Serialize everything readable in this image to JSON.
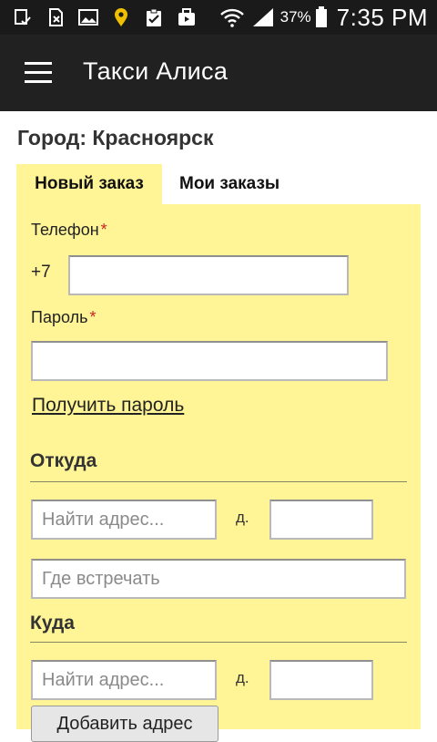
{
  "status_bar": {
    "icons": [
      "download-done-icon",
      "sim-off-icon",
      "image-icon",
      "location-pin-icon",
      "clipboard-check-icon",
      "briefcase-icon"
    ],
    "wifi_icon": "wifi-icon",
    "signal_icon": "signal-icon",
    "battery_percent": "37%",
    "battery_icon": "battery-icon",
    "time": "7:35 PM"
  },
  "app_bar": {
    "menu_icon": "hamburger-menu-icon",
    "title": "Такси Алиса"
  },
  "city_label": "Город: Красноярск",
  "tabs": [
    {
      "label": "Новый заказ",
      "active": true
    },
    {
      "label": "Мои заказы",
      "active": false
    }
  ],
  "form": {
    "phone": {
      "label": "Телефон",
      "required_mark": "*",
      "prefix": "+7",
      "value": ""
    },
    "password": {
      "label": "Пароль",
      "required_mark": "*",
      "value": ""
    },
    "get_password_link": "Получить пароль",
    "from": {
      "heading": "Откуда",
      "address_placeholder": "Найти адрес...",
      "house_label": "д.",
      "house_value": "",
      "meeting_placeholder": "Где встречать"
    },
    "to": {
      "heading": "Куда",
      "address_placeholder": "Найти адрес...",
      "house_label": "д.",
      "house_value": ""
    },
    "add_address_button": "Добавить адрес"
  },
  "colors": {
    "status_bar_bg": "#1a1a1a",
    "app_bar_bg": "#212121",
    "form_bg": "#fff597",
    "required": "#cc2222"
  }
}
